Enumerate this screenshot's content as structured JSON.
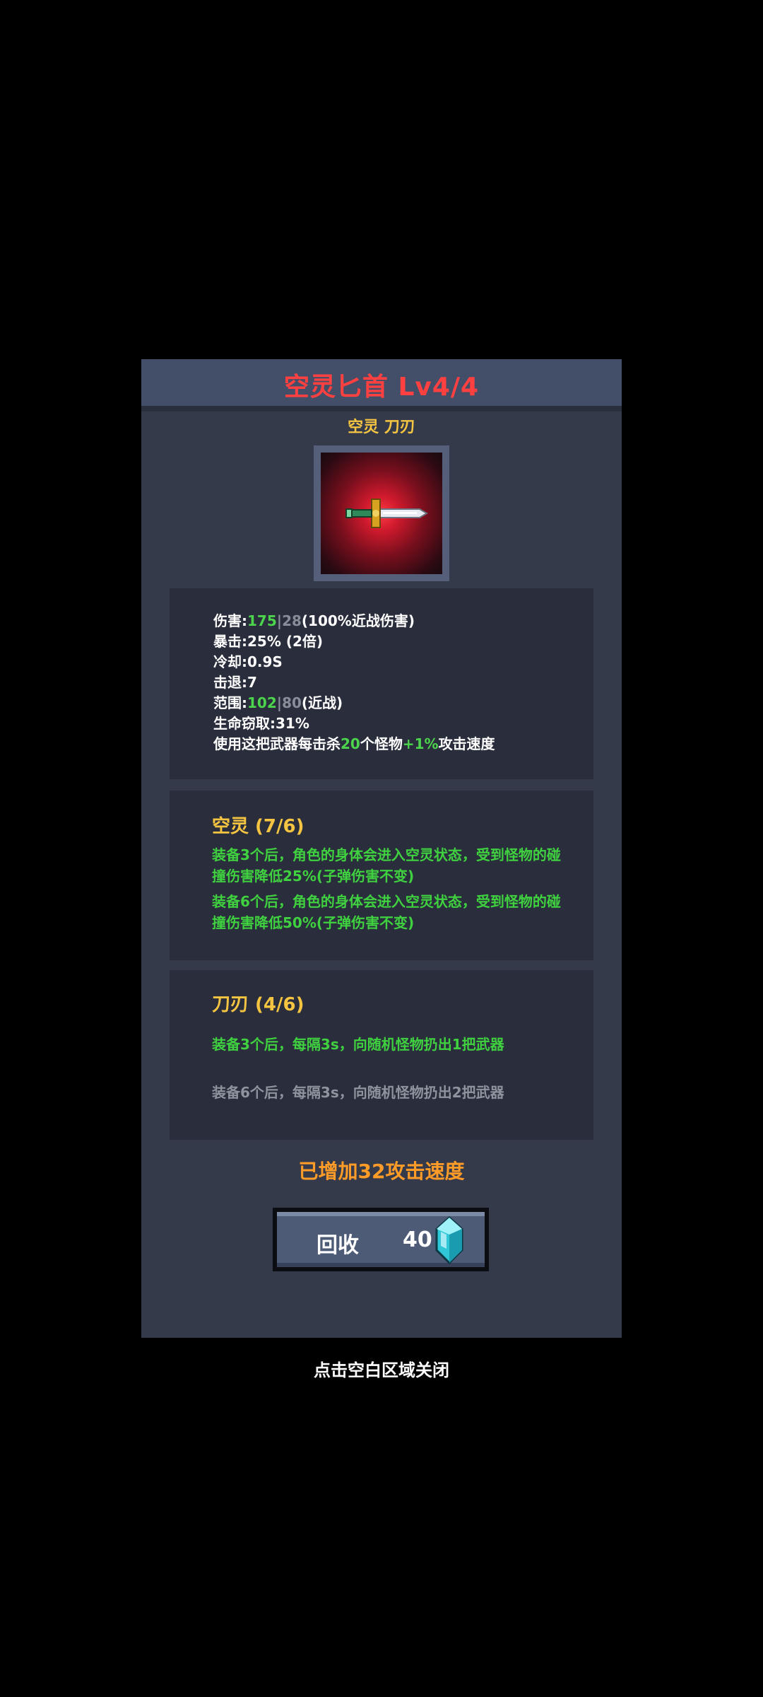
{
  "modal": {
    "title": "空灵匕首 Lv4/4",
    "tags": "空灵 刀刃",
    "weapon_icon": "dagger-icon"
  },
  "stats": {
    "damage": {
      "label": "伤害:",
      "value": "175",
      "sep": "|",
      "base": "28",
      "suffix": "(100%近战伤害)"
    },
    "crit": {
      "text": "暴击:25% (2倍)"
    },
    "cooldown": {
      "text": "冷却:0.9S"
    },
    "knockback": {
      "text": "击退:7"
    },
    "range": {
      "label": "范围:",
      "value": "102",
      "sep": "|",
      "base": "80",
      "suffix": "(近战)"
    },
    "lifesteal": {
      "text": "生命窃取:31%"
    },
    "kill_bonus": {
      "prefix": "使用这把武器每击杀",
      "count": "20",
      "middle": "个怪物",
      "bonus": "+1%",
      "suffix": "攻击速度"
    }
  },
  "sets": [
    {
      "title": "空灵 (7/6)",
      "effects": [
        {
          "text": "装备3个后，角色的身体会进入空灵状态，受到怪物的碰撞伤害降低25%(子弹伤害不变)",
          "active": true
        },
        {
          "text": "装备6个后，角色的身体会进入空灵状态，受到怪物的碰撞伤害降低50%(子弹伤害不变)",
          "active": true
        }
      ]
    },
    {
      "title": "刀刃 (4/6)",
      "effects": [
        {
          "text": "装备3个后，每隔3s，向随机怪物扔出1把武器",
          "active": true
        },
        {
          "text": "装备6个后，每隔3s，向随机怪物扔出2把武器",
          "active": false
        }
      ]
    }
  ],
  "bonus_text": "已增加32攻击速度",
  "recycle": {
    "label": "回收",
    "amount": "40",
    "icon": "gem-icon"
  },
  "close_hint": "点击空白区域关闭",
  "colors": {
    "title": "#ff4040",
    "tag": "#f5c542",
    "highlight": "#4cd44c",
    "bonus": "#ff9c28",
    "gem": "#39d6e6"
  }
}
